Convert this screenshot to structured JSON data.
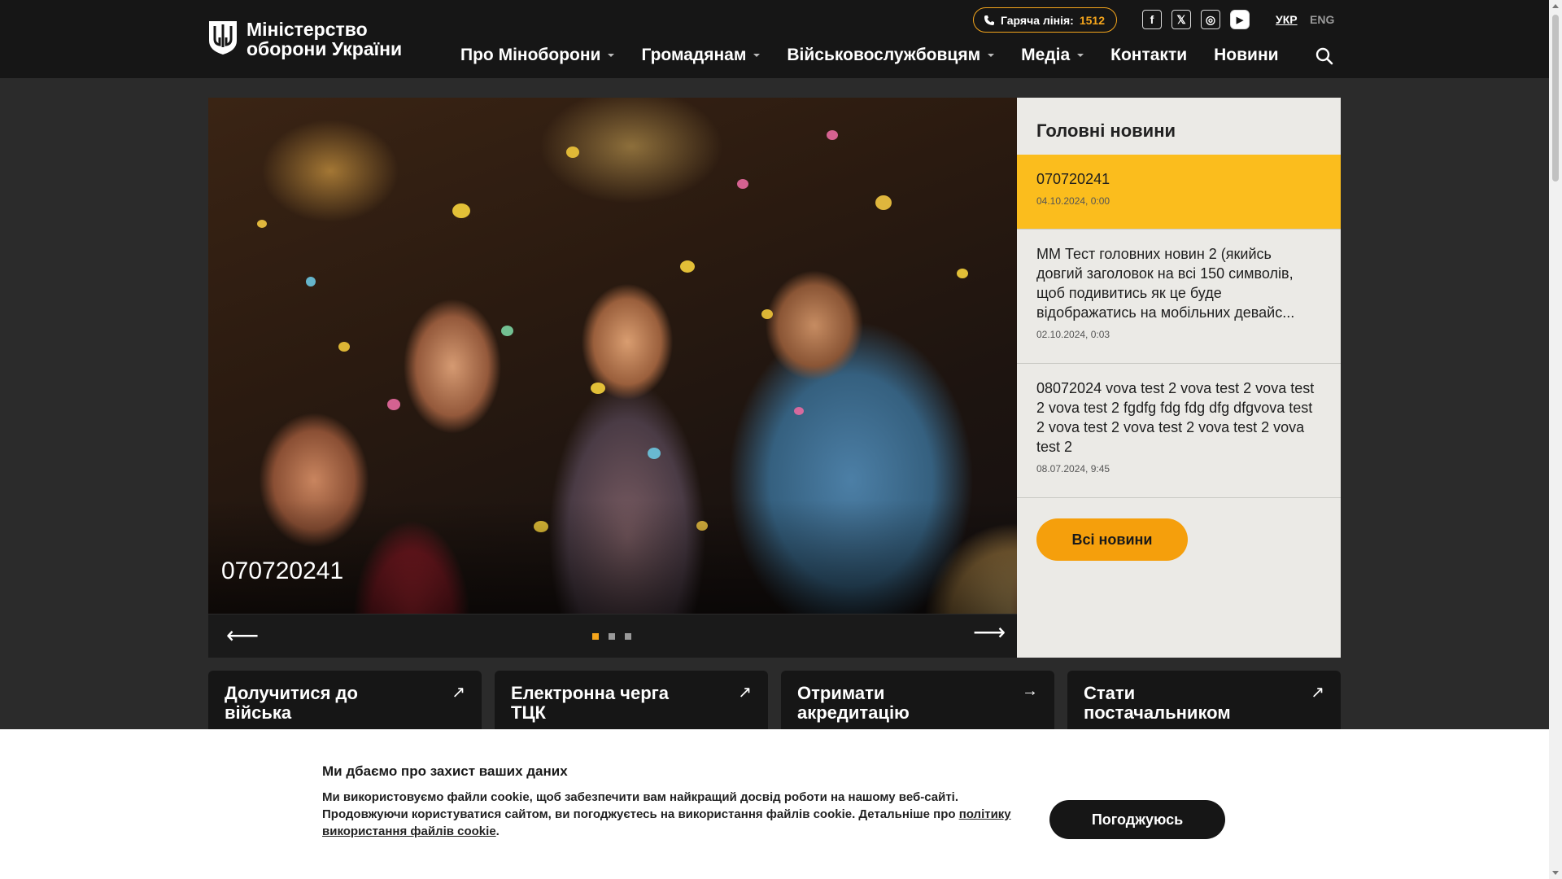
{
  "header": {
    "logo_text": "Міністерство оборони України",
    "hotline_label": "Гаряча лінія:",
    "hotline_number": "1512",
    "socials": [
      {
        "icon": "facebook-icon",
        "glyph": "f"
      },
      {
        "icon": "x-twitter-icon",
        "glyph": "𝕏"
      },
      {
        "icon": "instagram-icon",
        "glyph": "◎"
      },
      {
        "icon": "youtube-icon",
        "glyph": "▶"
      }
    ],
    "lang_ukr": "УКР",
    "lang_eng": "ENG",
    "nav": [
      {
        "label": "Про Міноборони",
        "dropdown": true
      },
      {
        "label": "Громадянам",
        "dropdown": true
      },
      {
        "label": "Військовослужбовцям",
        "dropdown": true
      },
      {
        "label": "Медіа",
        "dropdown": true
      },
      {
        "label": "Контакти",
        "dropdown": false
      },
      {
        "label": "Новини",
        "dropdown": false
      }
    ]
  },
  "slider": {
    "title": "070720241",
    "active_slide": 1,
    "slide_count": 3
  },
  "news": {
    "heading": "Головні новини",
    "items": [
      {
        "title": "070720241",
        "date": "04.10.2024, 0:00",
        "active": true
      },
      {
        "title": "ММ Тест головних новин 2 (якийсь довгий заголовок на всі 150 символів, щоб подивитись як це буде відображатись на мобільних девайс...",
        "date": "02.10.2024, 0:03",
        "active": false
      },
      {
        "title": "08072024 vova test 2 vova test 2 vova test 2 vova test 2 fgdfg fdg fdg dfg dfgvova test 2 vova test 2 vova test 2 vova test 2 vova test 2",
        "date": "08.07.2024, 9:45",
        "active": false
      }
    ],
    "all_button": "Всі новини"
  },
  "cards": [
    {
      "label": "Долучитися до війська",
      "icon": "arrow-up-right-icon",
      "glyph": "↗"
    },
    {
      "label": "Електронна черга ТЦК",
      "icon": "arrow-up-right-icon",
      "glyph": "↗"
    },
    {
      "label": "Отримати акредитацію",
      "icon": "arrow-right-icon",
      "glyph": "→"
    },
    {
      "label": "Стати постачальником",
      "icon": "arrow-up-right-icon",
      "glyph": "↗"
    }
  ],
  "cookie": {
    "title": "Ми дбаємо про захист ваших даних",
    "text": "Ми використовуємо файли cookie, щоб забезпечити вам найкращий досвід роботи на нашому веб-сайті. Продовжуючи користуватися сайтом, ви погоджуєтесь на використання файлів cookie. Детальніше про ",
    "link": "політику використання файлів cookie",
    "text_end": ".",
    "button": "Погоджуюсь"
  },
  "colors": {
    "accent": "#f4a51c",
    "header_bg": "#161616",
    "news_active": "#fbbd1d"
  }
}
